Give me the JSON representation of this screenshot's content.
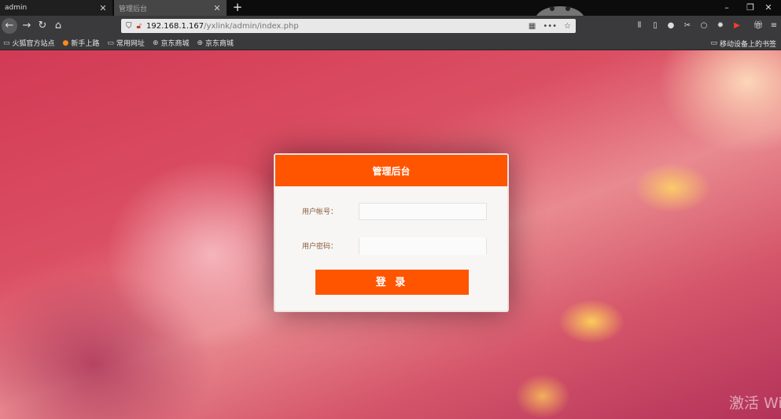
{
  "browser": {
    "tabs": [
      {
        "title": "admin",
        "active": true
      },
      {
        "title": "管理后台",
        "active": false
      }
    ],
    "address": {
      "host": "192.168.1.167",
      "path": "/yxlink/admin/index.php"
    },
    "bookmarks": [
      {
        "label": "火狐官方站点",
        "icon": "folder-icon"
      },
      {
        "label": "新手上路",
        "icon": "firefox-icon"
      },
      {
        "label": "常用网址",
        "icon": "folder-icon"
      },
      {
        "label": "京东商城",
        "icon": "globe-icon"
      },
      {
        "label": "京东商城",
        "icon": "globe-icon"
      }
    ],
    "bookmarks_right": "移动设备上的书签"
  },
  "login": {
    "title": "管理后台",
    "username_label": "用户帐号：",
    "password_label": "用户密码：",
    "username_value": "",
    "password_value": "",
    "submit_label": "登 录"
  },
  "watermark": "激活 Windows",
  "colors": {
    "accent": "#ff5500",
    "label": "#8a5a3a"
  }
}
